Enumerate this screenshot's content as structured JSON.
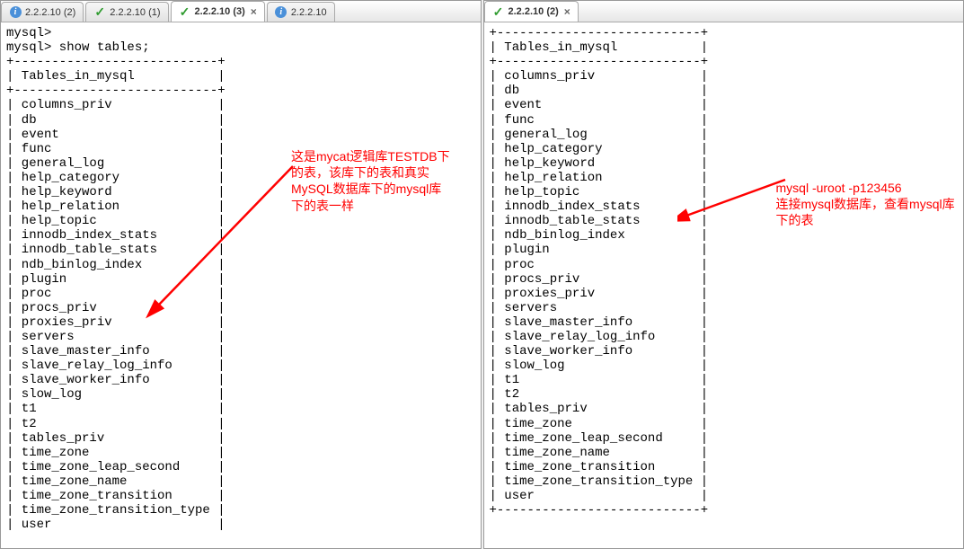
{
  "leftPane": {
    "tabs": [
      {
        "label": "2.2.2.10 (2)",
        "icon": "info",
        "active": false,
        "closable": false
      },
      {
        "label": "2.2.2.10 (1)",
        "icon": "check",
        "active": false,
        "closable": false
      },
      {
        "label": "2.2.2.10 (3)",
        "icon": "check",
        "active": true,
        "closable": true
      },
      {
        "label": "2.2.2.10",
        "icon": "info",
        "active": false,
        "closable": false
      }
    ],
    "prompt1": "mysql>",
    "prompt2": "mysql> show tables;",
    "border": "+---------------------------+",
    "headerRow": "| Tables_in_mysql           |",
    "tables": [
      "columns_priv",
      "db",
      "event",
      "func",
      "general_log",
      "help_category",
      "help_keyword",
      "help_relation",
      "help_topic",
      "innodb_index_stats",
      "innodb_table_stats",
      "ndb_binlog_index",
      "plugin",
      "proc",
      "procs_priv",
      "proxies_priv",
      "servers",
      "slave_master_info",
      "slave_relay_log_info",
      "slave_worker_info",
      "slow_log",
      "t1",
      "t2",
      "tables_priv",
      "time_zone",
      "time_zone_leap_second",
      "time_zone_name",
      "time_zone_transition",
      "time_zone_transition_type",
      "user"
    ],
    "annotation": "这是mycat逻辑库TESTDB下的表，该库下的表和真实MySQL数据库下的mysql库下的表一样"
  },
  "rightPane": {
    "tabs": [
      {
        "label": "2.2.2.10 (2)",
        "icon": "check",
        "active": true,
        "closable": true
      }
    ],
    "border": "+---------------------------+",
    "headerRow": "| Tables_in_mysql           |",
    "tables": [
      "columns_priv",
      "db",
      "event",
      "func",
      "general_log",
      "help_category",
      "help_keyword",
      "help_relation",
      "help_topic",
      "innodb_index_stats",
      "innodb_table_stats",
      "ndb_binlog_index",
      "plugin",
      "proc",
      "procs_priv",
      "proxies_priv",
      "servers",
      "slave_master_info",
      "slave_relay_log_info",
      "slave_worker_info",
      "slow_log",
      "t1",
      "t2",
      "tables_priv",
      "time_zone",
      "time_zone_leap_second",
      "time_zone_name",
      "time_zone_transition",
      "time_zone_transition_type",
      "user"
    ],
    "annotation": "mysql -uroot -p123456\n连接mysql数据库，查看mysql库下的表"
  }
}
